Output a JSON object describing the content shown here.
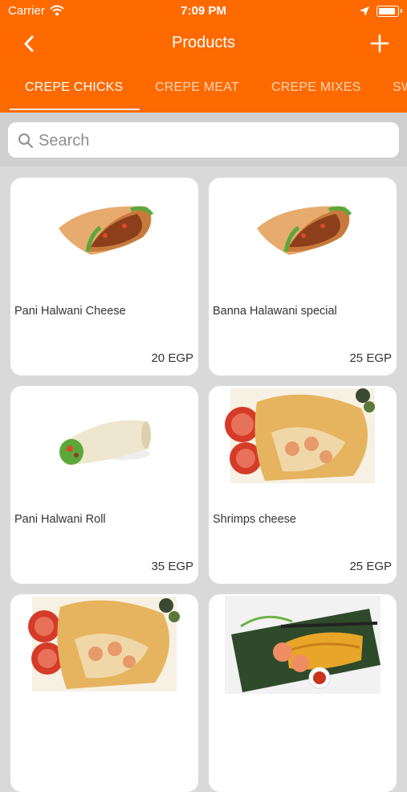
{
  "status": {
    "carrier": "Carrier",
    "time": "7:09 PM"
  },
  "nav": {
    "title": "Products",
    "back_icon": "chevron-left-icon",
    "add_icon": "plus-icon"
  },
  "tabs": [
    {
      "label": "CREPE CHICKS",
      "active": true
    },
    {
      "label": "CREPE MEAT",
      "active": false
    },
    {
      "label": "CREPE MIXES",
      "active": false
    },
    {
      "label": "SW",
      "active": false
    }
  ],
  "search": {
    "placeholder": "Search",
    "value": ""
  },
  "products": [
    {
      "name": "Pani Halwani Cheese",
      "price": "20 EGP"
    },
    {
      "name": "Banna Halawani special",
      "price": "25 EGP"
    },
    {
      "name": "Pani Halwani Roll",
      "price": "35 EGP"
    },
    {
      "name": "Shrimps cheese",
      "price": "25 EGP"
    },
    {
      "name": "",
      "price": ""
    },
    {
      "name": "",
      "price": ""
    }
  ],
  "colors": {
    "accent": "#ff6a00",
    "background": "#d9d9d9",
    "card": "#ffffff"
  }
}
